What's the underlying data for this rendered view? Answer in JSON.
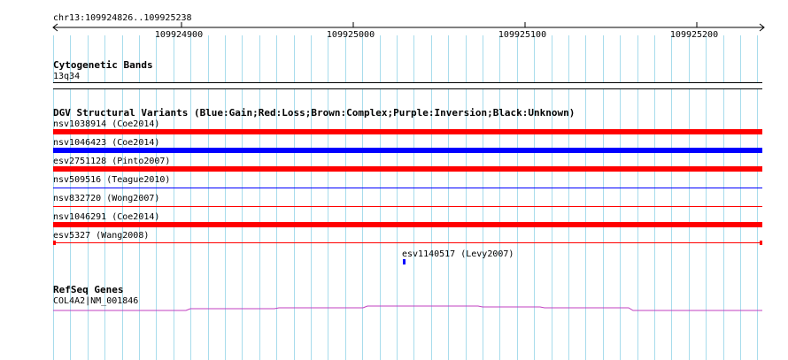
{
  "ruler": {
    "location": "chr13:109924826..109925238",
    "ticks": [
      "109924900",
      "109925000",
      "109925100",
      "109925200"
    ]
  },
  "cytoband": {
    "title": "Cytogenetic Bands",
    "band_label": "13q34"
  },
  "dgv": {
    "title": "DGV Structural Variants (Blue:Gain;Red:Loss;Brown:Complex;Purple:Inversion;Black:Unknown)",
    "features": [
      {
        "label": "nsv1038914 (Coe2014)",
        "color": "#ff0000",
        "kind": "thick"
      },
      {
        "label": "nsv1046423 (Coe2014)",
        "color": "#0000ff",
        "kind": "thick"
      },
      {
        "label": "esv2751128 (Pinto2007)",
        "color": "#ff0000",
        "kind": "thick"
      },
      {
        "label": "nsv509516 (Teague2010)",
        "color": "#0000ff",
        "kind": "thin"
      },
      {
        "label": "nsv832720 (Wong2007)",
        "color": "#ff0000",
        "kind": "thin"
      },
      {
        "label": "nsv1046291 (Coe2014)",
        "color": "#ff0000",
        "kind": "thick"
      },
      {
        "label": "esv5327 (Wang2008)",
        "color": "#ff0000",
        "kind": "bracketed"
      },
      {
        "label": "esv1140517 (Levy2007)",
        "color": "#0000ff",
        "kind": "small"
      }
    ]
  },
  "refseq": {
    "title": "RefSeq Genes",
    "gene_label": "COL4A2|NM_001846",
    "color": "#c040c0"
  },
  "colors": {
    "grid": "#a8dcec",
    "ruler": "#000000"
  }
}
